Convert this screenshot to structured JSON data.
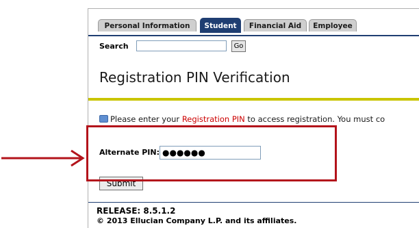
{
  "tabs": [
    {
      "label": "Personal Information",
      "active": false
    },
    {
      "label": "Student",
      "active": true
    },
    {
      "label": "Financial Aid",
      "active": false
    },
    {
      "label": "Employee",
      "active": false
    }
  ],
  "search": {
    "label": "Search",
    "value": "",
    "go_label": "Go"
  },
  "page_title": "Registration PIN Verification",
  "info": {
    "prefix": "Please enter your ",
    "link_text": "Registration PIN",
    "suffix": " to access registration. You must co"
  },
  "pin": {
    "label": "Alternate PIN:",
    "value": "●●●●●●"
  },
  "submit_label": "Submit",
  "footer": {
    "release": "RELEASE: 8.5.1.2",
    "copyright": "© 2013 Ellucian Company L.P. and its affiliates."
  },
  "colors": {
    "tab_active_bg": "#1f3e72",
    "gold_rule": "#c9c500",
    "link_red": "#cc0000",
    "annotation_red": "#b3131b"
  },
  "icons": {
    "info": "speech-bubble-icon",
    "pointer": "arrow-right-icon"
  }
}
